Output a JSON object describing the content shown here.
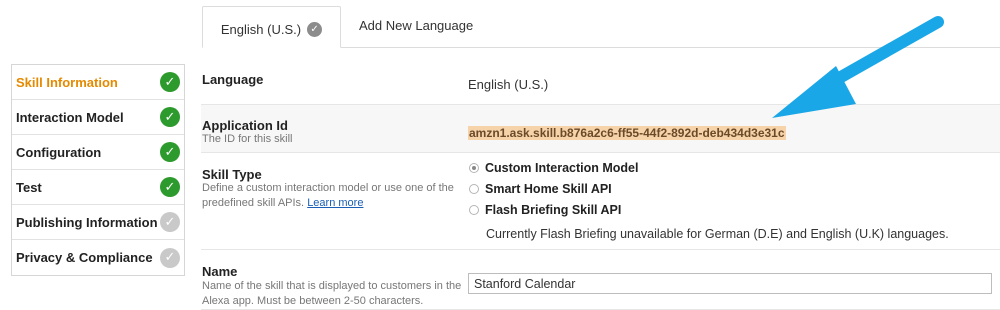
{
  "tabs": {
    "active_label": "English (U.S.)",
    "add_label": "Add New Language"
  },
  "sidebar": {
    "items": [
      {
        "label": "Skill Information",
        "status": "done",
        "active": true
      },
      {
        "label": "Interaction Model",
        "status": "done",
        "active": false
      },
      {
        "label": "Configuration",
        "status": "done",
        "active": false
      },
      {
        "label": "Test",
        "status": "done",
        "active": false
      },
      {
        "label": "Publishing Information",
        "status": "pending",
        "active": false
      },
      {
        "label": "Privacy & Compliance",
        "status": "pending",
        "active": false
      }
    ]
  },
  "form": {
    "language": {
      "label": "Language",
      "value": "English (U.S.)"
    },
    "application_id": {
      "label": "Application Id",
      "description": "The ID for this skill",
      "value": "amzn1.ask.skill.b876a2c6-ff55-44f2-892d-deb434d3e31c"
    },
    "skill_type": {
      "label": "Skill Type",
      "description": "Define a custom interaction model or use one of the predefined skill APIs.",
      "learn_more": "Learn more",
      "options": [
        {
          "label": "Custom Interaction Model",
          "selected": true
        },
        {
          "label": "Smart Home Skill API",
          "selected": false
        },
        {
          "label": "Flash Briefing Skill API",
          "selected": false
        }
      ],
      "flash_note": "Currently Flash Briefing unavailable for German (D.E) and English (U.K) languages."
    },
    "name": {
      "label": "Name",
      "description": "Name of the skill that is displayed to customers in the Alexa app. Must be between 2-50 characters.",
      "value": "Stanford Calendar"
    }
  },
  "colors": {
    "accent_orange": "#e58a00",
    "check_green": "#2d9a2d",
    "check_gray": "#c9c9c9",
    "highlight": "#f6d3a8",
    "arrow_blue": "#1aa7e8"
  }
}
